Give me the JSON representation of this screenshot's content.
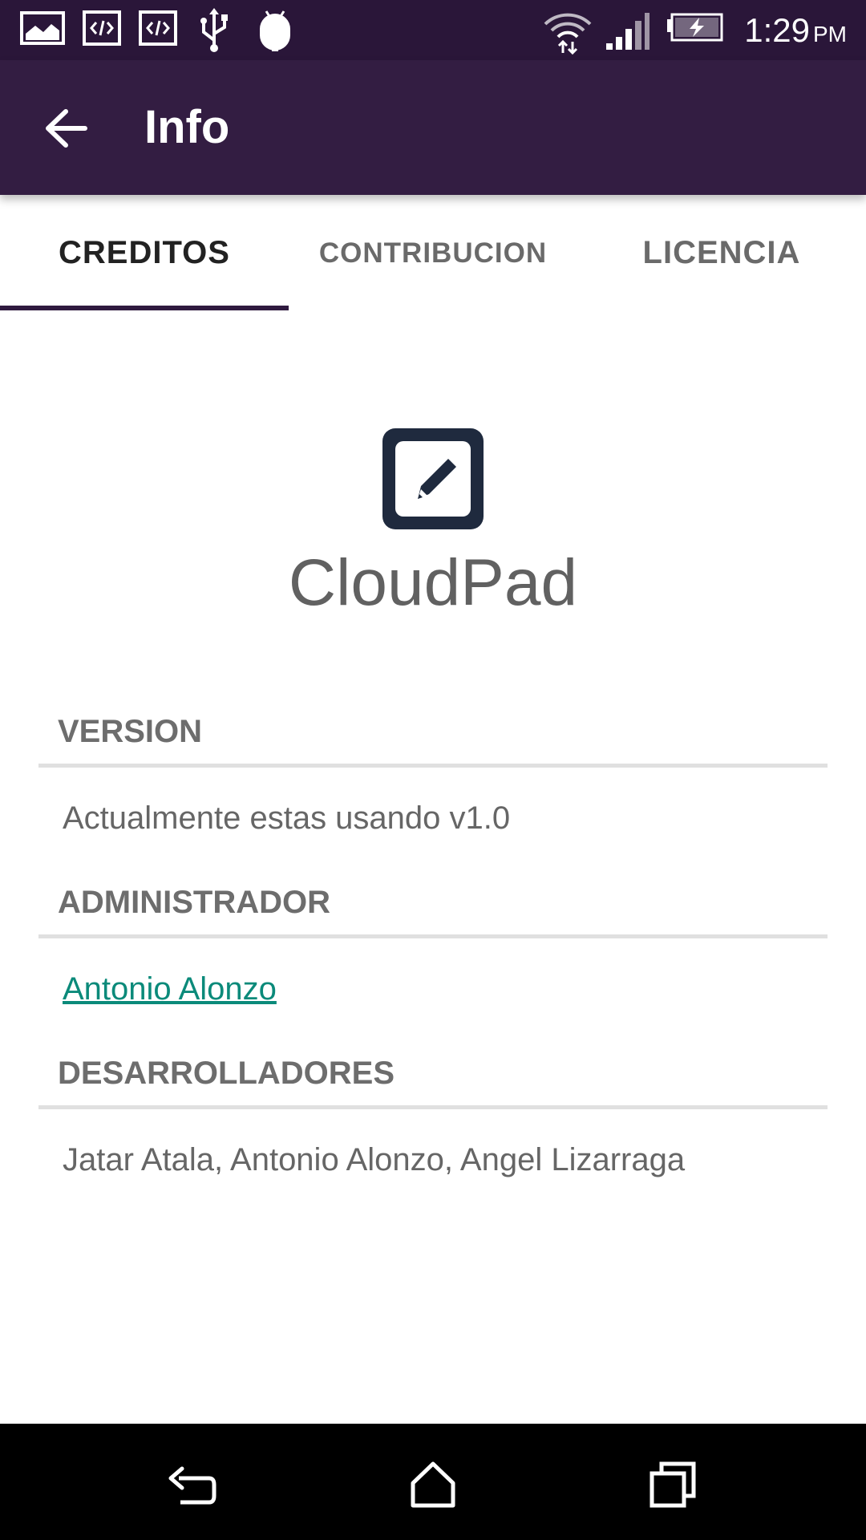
{
  "status_bar": {
    "time": "1:29",
    "ampm": "PM",
    "icons": [
      "gallery-icon",
      "code-icon",
      "code-icon",
      "usb-icon",
      "android-debug-icon",
      "wifi-icon",
      "signal-icon",
      "battery-charging-icon"
    ]
  },
  "appbar": {
    "title": "Info"
  },
  "tabs": [
    {
      "label": "CREDITOS",
      "active": true
    },
    {
      "label": "CONTRIBUCION",
      "active": false
    },
    {
      "label": "LICENCIA",
      "active": false
    }
  ],
  "app": {
    "name": "CloudPad",
    "icon": "edit-note-icon"
  },
  "sections": [
    {
      "header": "VERSION",
      "text": "Actualmente estas usando v1.0"
    },
    {
      "header": "ADMINISTRADOR",
      "text": "Antonio Alonzo"
    },
    {
      "header": "DESARROLLADORES",
      "text": "Jatar Atala, Antonio Alonzo, Angel Lizarraga"
    }
  ],
  "colors": {
    "status_bar": "#2a1639",
    "app_bar": "#331d42",
    "tab_indicator": "#2f1a3f",
    "link": "#0b8a7a",
    "logo": "#1f2a3e"
  }
}
